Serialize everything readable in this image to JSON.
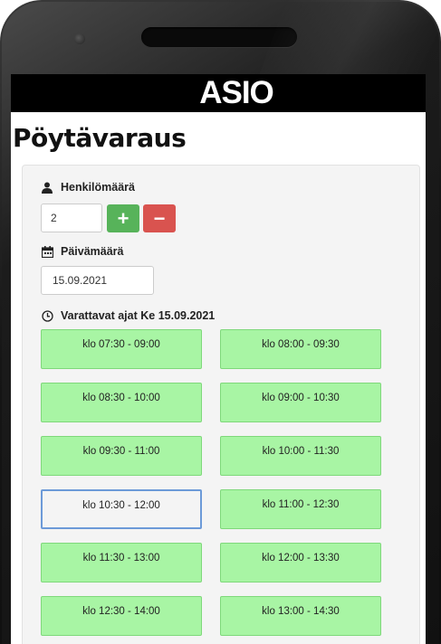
{
  "app": {
    "brand": "ASIO",
    "page_title": "Pöytävaraus"
  },
  "form": {
    "persons": {
      "label": "Henkilömäärä",
      "value": "2",
      "plus_label": "+",
      "minus_label": "−"
    },
    "date": {
      "label": "Päivämäärä",
      "value": "15.09.2021"
    },
    "times": {
      "label": "Varattavat ajat Ke 15.09.2021",
      "slots": [
        {
          "label": "klo 07:30 - 09:00",
          "selected": false
        },
        {
          "label": "klo 08:00 - 09:30",
          "selected": false
        },
        {
          "label": "klo 08:30 - 10:00",
          "selected": false
        },
        {
          "label": "klo 09:00 - 10:30",
          "selected": false
        },
        {
          "label": "klo 09:30 - 11:00",
          "selected": false
        },
        {
          "label": "klo 10:00 - 11:30",
          "selected": false
        },
        {
          "label": "klo 10:30 - 12:00",
          "selected": true
        },
        {
          "label": "klo 11:00 - 12:30",
          "selected": false
        },
        {
          "label": "klo 11:30 - 13:00",
          "selected": false
        },
        {
          "label": "klo 12:00 - 13:30",
          "selected": false
        },
        {
          "label": "klo 12:30 - 14:00",
          "selected": false
        },
        {
          "label": "klo 13:00 - 14:30",
          "selected": false
        }
      ]
    }
  },
  "colors": {
    "slot_available": "#a8f5a4",
    "slot_selected_border": "#6c9ad8",
    "plus_button": "#57b35a",
    "minus_button": "#d9534f"
  },
  "icons": {
    "persons": "user-icon",
    "date": "calendar-icon",
    "times": "clock-icon"
  }
}
